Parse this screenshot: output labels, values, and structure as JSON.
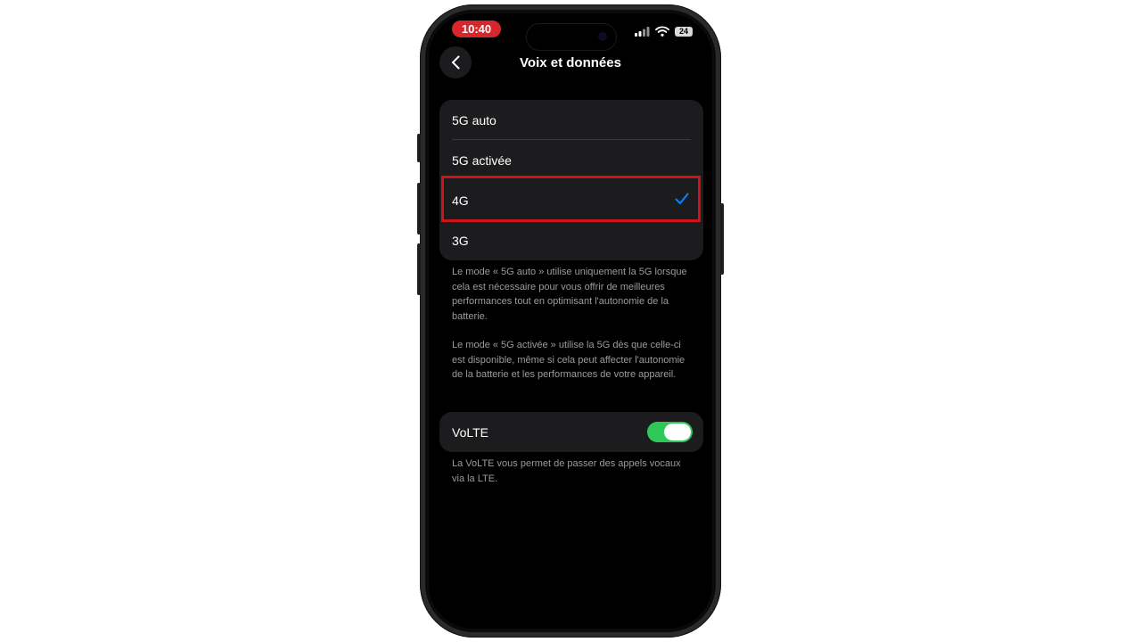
{
  "status_bar": {
    "time": "10:40",
    "battery": "24"
  },
  "nav": {
    "title": "Voix et données"
  },
  "network_options": [
    {
      "label": "5G auto",
      "selected": false
    },
    {
      "label": "5G activée",
      "selected": false
    },
    {
      "label": "4G",
      "selected": true
    },
    {
      "label": "3G",
      "selected": false
    }
  ],
  "notes": {
    "auto": "Le mode « 5G auto » utilise uniquement la 5G lorsque cela est nécessaire pour vous offrir de meilleures performances tout en optimisant l'autonomie de la batterie.",
    "activated": "Le mode « 5G activée » utilise la 5G dès que celle-ci est disponible, même si cela peut affecter l'autonomie de la batterie et les performances de votre appareil."
  },
  "volte": {
    "label": "VoLTE",
    "enabled": true,
    "footnote": "La VoLTE vous permet de passer des appels vocaux via la LTE."
  },
  "colors": {
    "accent": "#0a84ff",
    "toggle_on": "#30c759",
    "time_pill": "#d8262d",
    "highlight": "#d0121b"
  }
}
